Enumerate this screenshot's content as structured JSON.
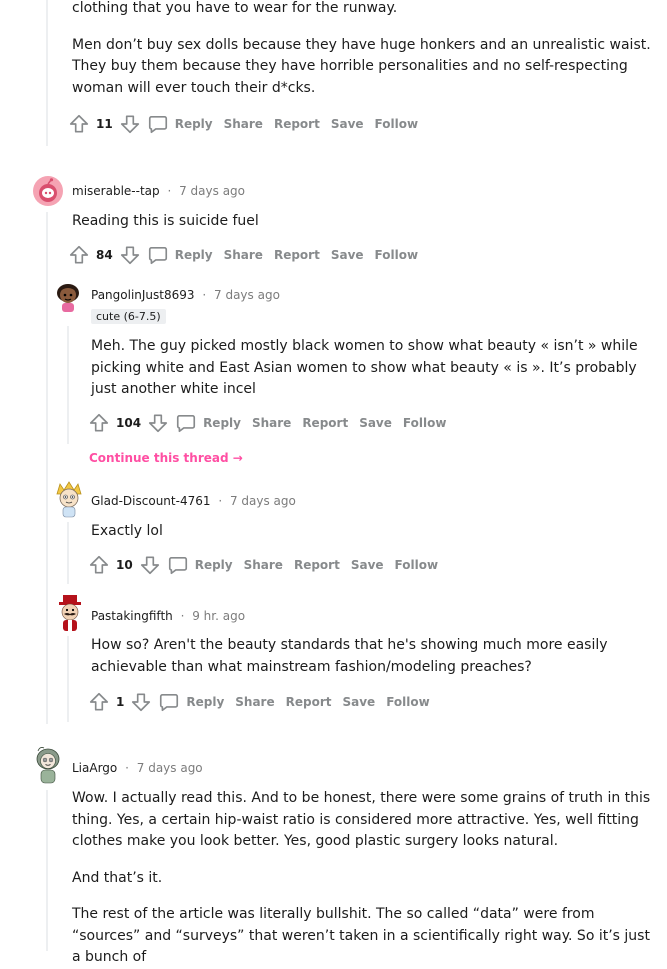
{
  "comments": {
    "c0": {
      "body": [
        "clothing that you have to wear for the runway.",
        "Men don’t buy sex dolls because they have huge honkers and an unrealistic waist. They buy them because they have horrible personalities and no self-respecting woman will ever touch their d*cks."
      ],
      "votes": "11"
    },
    "c1": {
      "user": "miserable--tap",
      "time": "7 days ago",
      "body": "Reading this is suicide fuel",
      "votes": "84"
    },
    "c2": {
      "user": "PangolinJust8693",
      "time": "7 days ago",
      "flair": "cute (6-7.5)",
      "body": "Meh. The guy picked mostly black women to show what beauty « isn’t » while picking white and East Asian women to show what beauty « is ». It’s probably just another white incel",
      "votes": "104",
      "continue": "Continue this thread →"
    },
    "c3": {
      "user": "Glad-Discount-4761",
      "time": "7 days ago",
      "body": "Exactly lol",
      "votes": "10"
    },
    "c4": {
      "user": "Pastakingfifth",
      "time": "9 hr. ago",
      "body": "How so? Aren't the beauty standards that he's showing much more easily achievable than what mainstream fashion/modeling preaches?",
      "votes": "1"
    },
    "c5": {
      "user": "LiaArgo",
      "time": "7 days ago",
      "body": [
        "Wow. I actually read this. And to be honest, there were some grains of truth in this thing. Yes, a certain hip-waist ratio is considered more attractive. Yes, well fitting clothes make you look better. Yes, good plastic surgery looks natural.",
        "And that’s it.",
        "The rest of the article was literally bullshit. The so called “data” were from “sources” and “surveys” that weren’t taken in a scientifically right way. So it’s just a bunch of"
      ]
    }
  },
  "actions": {
    "reply": "Reply",
    "share": "Share",
    "report": "Report",
    "save": "Save",
    "follow": "Follow"
  },
  "separator": "·",
  "colors": {
    "continue_link": "#ff4fa3",
    "action_gray": "#878a8c",
    "thread_line": "#edeff1"
  }
}
